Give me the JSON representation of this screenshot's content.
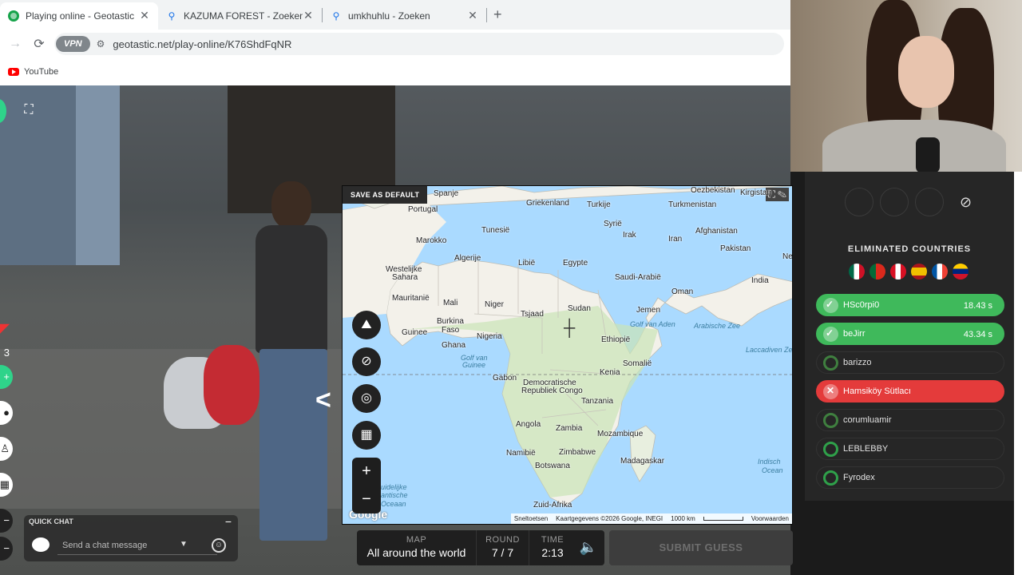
{
  "browser": {
    "tabs": [
      {
        "title": "Playing online - Geotastic",
        "icon": "geotastic-icon",
        "active": true
      },
      {
        "title": "KAZUMA FOREST - Zoeken",
        "icon": "search-icon",
        "active": false
      },
      {
        "title": "umkhuhlu - Zoeken",
        "icon": "search-icon",
        "active": false
      }
    ],
    "new_tab": "+",
    "close": "✕",
    "vpn_label": "VPN",
    "url": "geotastic.net/play-online/K76ShdFqNR",
    "bookmark": "YouTube"
  },
  "map": {
    "save_default": "SAVE AS DEFAULT",
    "google": "Google",
    "footer": {
      "shortcuts": "Sneltoetsen",
      "mapdata": "Kaartgegevens ©2026 Google, INEGI",
      "scale": "1000 km",
      "terms": "Voorwaarden"
    },
    "labels": [
      {
        "text": "Spanje"
      },
      {
        "text": "Portugal"
      },
      {
        "text": "Griekenland"
      },
      {
        "text": "Turkije"
      },
      {
        "text": "Oezbekistan"
      },
      {
        "text": "Kirgistan"
      },
      {
        "text": "Turkmenistan"
      },
      {
        "text": "Syrië"
      },
      {
        "text": "Tunesië"
      },
      {
        "text": "Marokko"
      },
      {
        "text": "Irak"
      },
      {
        "text": "Iran"
      },
      {
        "text": "Afghanistan"
      },
      {
        "text": "Algerije"
      },
      {
        "text": "Libië"
      },
      {
        "text": "Egypte"
      },
      {
        "text": "Pakistan"
      },
      {
        "text": "Ne"
      },
      {
        "text": "Westelijke"
      },
      {
        "text": "Sahara"
      },
      {
        "text": "Saudi-Arabië"
      },
      {
        "text": "India"
      },
      {
        "text": "Oman"
      },
      {
        "text": "Mauritanië"
      },
      {
        "text": "Mali"
      },
      {
        "text": "Niger"
      },
      {
        "text": "Sudan"
      },
      {
        "text": "Tsjaad"
      },
      {
        "text": "Jemen"
      },
      {
        "text": "Burkina"
      },
      {
        "text": "Faso"
      },
      {
        "text": "Guinee"
      },
      {
        "text": "Nigeria"
      },
      {
        "text": "Ethiopië"
      },
      {
        "text": "Ghana"
      },
      {
        "text": "Gabon"
      },
      {
        "text": "Somalië"
      },
      {
        "text": "Kenia"
      },
      {
        "text": "Democratische"
      },
      {
        "text": "Republiek Congo"
      },
      {
        "text": "Tanzania"
      },
      {
        "text": "Angola"
      },
      {
        "text": "Zambia"
      },
      {
        "text": "Mozambique"
      },
      {
        "text": "Namibië"
      },
      {
        "text": "Zimbabwe"
      },
      {
        "text": "Botswana"
      },
      {
        "text": "Madagaskar"
      },
      {
        "text": "Zuid-Afrika"
      }
    ],
    "water_labels": [
      {
        "text": "Golf van Aden"
      },
      {
        "text": "Arabische Zee"
      },
      {
        "text": "Laccadiven Zee"
      },
      {
        "text": "Golf van"
      },
      {
        "text": "Guinee"
      },
      {
        "text": "Indisch"
      },
      {
        "text": "Ocean"
      },
      {
        "text": "uidelijke"
      },
      {
        "text": "antische"
      },
      {
        "text": "Oceaan"
      }
    ]
  },
  "map_buttons": [
    "terrain-icon",
    "hide-icon",
    "locate-icon",
    "layers-icon"
  ],
  "zoom": {
    "in": "+",
    "out": "−"
  },
  "quick_chat": {
    "title": "QUICK CHAT",
    "placeholder": "Send a chat message",
    "minimize": "−"
  },
  "game_info": {
    "map_label": "MAP",
    "map_value": "All around the world",
    "round_label": "ROUND",
    "round_value": "7 / 7",
    "time_label": "TIME",
    "time_value": "2:13"
  },
  "submit_label": "SUBMIT GUESS",
  "panel": {
    "eliminated_title": "ELIMINATED COUNTRIES",
    "flags": [
      "mexico-flag",
      "portugal-flag",
      "peru-flag",
      "spain-flag",
      "france-flag",
      "venezuela-flag"
    ],
    "players": [
      {
        "name": "HSc0rpi0",
        "time": "18.43 s",
        "status": "guessed"
      },
      {
        "name": "beJirr",
        "time": "43.34 s",
        "status": "guessed"
      },
      {
        "name": "barizzo",
        "time": "",
        "status": "waiting"
      },
      {
        "name": "Hamsiköy Sütlacı",
        "time": "",
        "status": "eliminated"
      },
      {
        "name": "corumluamir",
        "time": "",
        "status": "waiting"
      },
      {
        "name": "LEBLEBBY",
        "time": "",
        "status": "waiting"
      },
      {
        "name": "Fyrodex",
        "time": "",
        "status": "waiting"
      }
    ]
  },
  "left_badge": "3",
  "colors": {
    "accent_green": "#3fb95b",
    "eliminated_red": "#e43b3b",
    "sea": "#aadaff",
    "land": "#f5f3ee"
  }
}
